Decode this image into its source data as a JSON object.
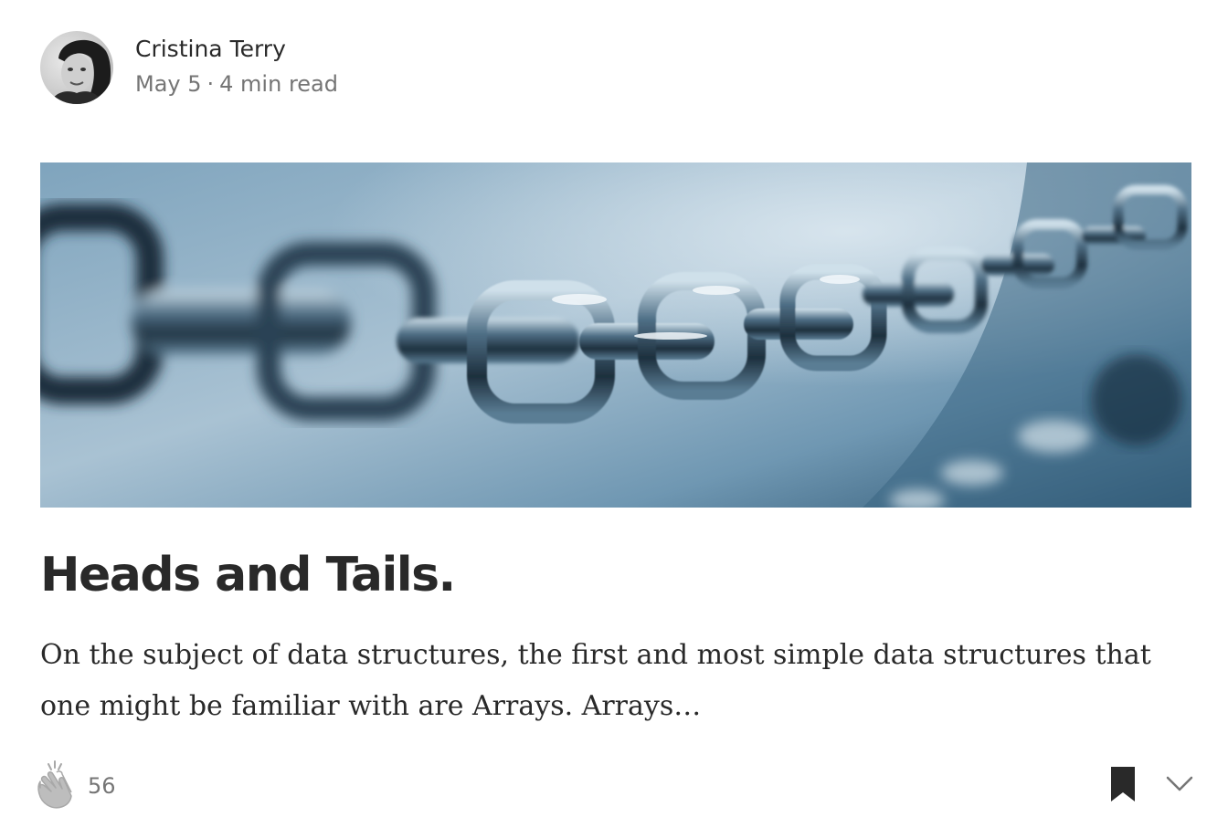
{
  "author": {
    "name": "Cristina Terry",
    "avatar_icon": "author-avatar"
  },
  "meta": {
    "date": "May 5",
    "separator": "·",
    "read_time": "4 min read"
  },
  "hero": {
    "icon": "chain-photo",
    "colors": {
      "bg_light": "#a9c2d3",
      "bg_mid": "#5f8aa6",
      "bg_dark": "#2c5470",
      "metal": "#1d2f3d"
    }
  },
  "article": {
    "title": "Heads and Tails.",
    "excerpt": "On the subject of data structures, the first and most simple data structures that one might be familiar with are Arrays. Arrays…"
  },
  "actions": {
    "clap_icon": "clap-icon",
    "clap_count": "56",
    "bookmark_icon": "bookmark-icon",
    "more_icon": "chevron-down-icon"
  },
  "colors": {
    "text_primary": "#292929",
    "text_secondary": "#757575",
    "icon_gray": "#a8a8a8"
  }
}
